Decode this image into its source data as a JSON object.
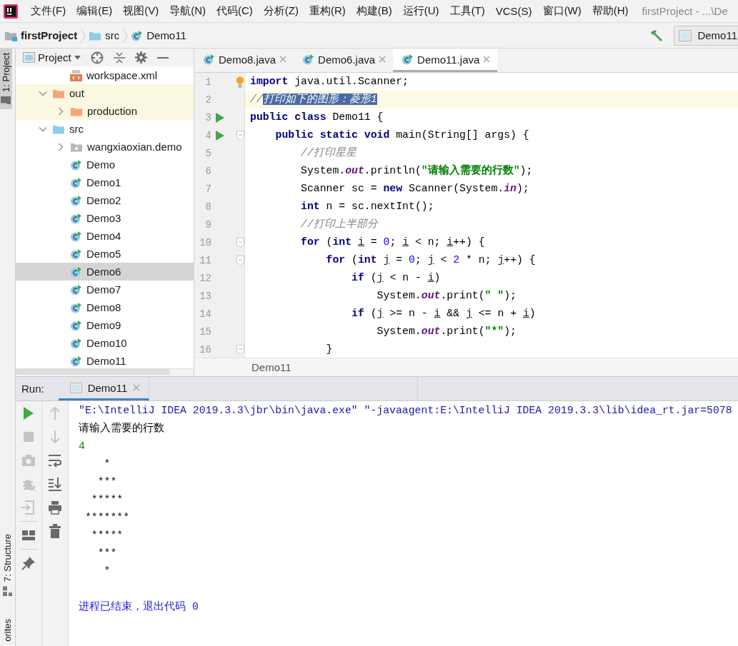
{
  "menu_bar": {
    "items": [
      "文件(F)",
      "编辑(E)",
      "视图(V)",
      "导航(N)",
      "代码(C)",
      "分析(Z)",
      "重构(R)",
      "构建(B)",
      "运行(U)",
      "工具(T)",
      "VCS(S)",
      "窗口(W)",
      "帮助(H)"
    ],
    "title": "firstProject - ...\\De"
  },
  "nav_bar": {
    "breadcrumbs": [
      {
        "label": "firstProject",
        "kind": "project"
      },
      {
        "label": "src",
        "kind": "folder"
      },
      {
        "label": "Demo11",
        "kind": "class"
      }
    ],
    "run_config": "Demo11"
  },
  "tool_stripe": {
    "top": [
      {
        "label": "1: Project",
        "selected": true
      }
    ],
    "bottom": [
      {
        "label": "7: Structure",
        "selected": false
      },
      {
        "label": "orites",
        "selected": false
      }
    ]
  },
  "project_panel": {
    "title": "Project",
    "tree": {
      "scrolled_parent_children": [
        {
          "label": "workspace.xml",
          "kind": "xml",
          "selected": false
        }
      ],
      "items": [
        {
          "label": "out",
          "kind": "excluded-folder",
          "expanded": true,
          "selected": false,
          "children": [
            {
              "label": "production",
              "kind": "excluded-folder",
              "expanded": false,
              "selected": false
            }
          ]
        },
        {
          "label": "src",
          "kind": "source-folder",
          "expanded": true,
          "selected": false,
          "children": [
            {
              "label": "wangxiaoxian.demo",
              "kind": "package",
              "expanded": false,
              "selected": false
            },
            {
              "label": "Demo",
              "kind": "class",
              "selected": false
            },
            {
              "label": "Demo1",
              "kind": "class",
              "selected": false
            },
            {
              "label": "Demo2",
              "kind": "class",
              "selected": false
            },
            {
              "label": "Demo3",
              "kind": "class",
              "selected": false
            },
            {
              "label": "Demo4",
              "kind": "class",
              "selected": false
            },
            {
              "label": "Demo5",
              "kind": "class",
              "selected": false
            },
            {
              "label": "Demo6",
              "kind": "class",
              "selected": true
            },
            {
              "label": "Demo7",
              "kind": "class",
              "selected": false
            },
            {
              "label": "Demo8",
              "kind": "class",
              "selected": false
            },
            {
              "label": "Demo9",
              "kind": "class",
              "selected": false
            },
            {
              "label": "Demo10",
              "kind": "class",
              "selected": false
            },
            {
              "label": "Demo11",
              "kind": "class",
              "selected": false
            }
          ]
        }
      ]
    }
  },
  "editor": {
    "tabs": [
      {
        "label": "Demo8.java",
        "selected": false
      },
      {
        "label": "Demo6.java",
        "selected": false
      },
      {
        "label": "Demo11.java",
        "selected": true
      }
    ],
    "lines": [
      {
        "number": "1",
        "current": false,
        "run": false,
        "fold": false,
        "bulb": true,
        "tokens": [
          {
            "text": "import",
            "kind": "keyword"
          },
          {
            "text": " java.util.Scanner;",
            "kind": "plain"
          }
        ]
      },
      {
        "number": "2",
        "current": true,
        "run": false,
        "fold": false,
        "tokens": [
          {
            "text": "//",
            "kind": "comment"
          },
          {
            "text": "打印如下的图形：菱形1",
            "kind": "comment",
            "selected": true
          }
        ]
      },
      {
        "number": "3",
        "current": false,
        "run": true,
        "fold": false,
        "tokens": [
          {
            "text": "public class",
            "kind": "keyword"
          },
          {
            "text": " Demo11 {",
            "kind": "plain"
          }
        ]
      },
      {
        "number": "4",
        "current": false,
        "run": true,
        "fold": true,
        "tokens": [
          {
            "text": "    public static void",
            "kind": "keyword"
          },
          {
            "text": " main(String[] args) {",
            "kind": "plain"
          }
        ]
      },
      {
        "number": "5",
        "current": false,
        "run": false,
        "fold": false,
        "tokens": [
          {
            "text": "        //打印星星",
            "kind": "comment"
          }
        ]
      },
      {
        "number": "6",
        "current": false,
        "run": false,
        "fold": false,
        "tokens": [
          {
            "text": "        System.",
            "kind": "plain"
          },
          {
            "text": "out",
            "kind": "field"
          },
          {
            "text": ".println(",
            "kind": "plain"
          },
          {
            "text": "\"请输入需要的行数\"",
            "kind": "string"
          },
          {
            "text": ");",
            "kind": "plain"
          }
        ]
      },
      {
        "number": "7",
        "current": false,
        "run": false,
        "fold": false,
        "tokens": [
          {
            "text": "        Scanner sc = ",
            "kind": "plain"
          },
          {
            "text": "new",
            "kind": "keyword"
          },
          {
            "text": " Scanner(System.",
            "kind": "plain"
          },
          {
            "text": "in",
            "kind": "field"
          },
          {
            "text": ");",
            "kind": "plain"
          }
        ]
      },
      {
        "number": "8",
        "current": false,
        "run": false,
        "fold": false,
        "tokens": [
          {
            "text": "        int",
            "kind": "keyword"
          },
          {
            "text": " n = sc.nextInt();",
            "kind": "plain"
          }
        ]
      },
      {
        "number": "9",
        "current": false,
        "run": false,
        "fold": false,
        "tokens": [
          {
            "text": "        //打印上半部分",
            "kind": "comment"
          }
        ]
      },
      {
        "number": "10",
        "current": false,
        "run": false,
        "fold": true,
        "tokens": [
          {
            "text": "        for",
            "kind": "keyword"
          },
          {
            "text": " (",
            "kind": "plain"
          },
          {
            "text": "int ",
            "kind": "keyword"
          },
          {
            "text": "i",
            "kind": "variable"
          },
          {
            "text": " = ",
            "kind": "plain"
          },
          {
            "text": "0",
            "kind": "number"
          },
          {
            "text": "; ",
            "kind": "plain"
          },
          {
            "text": "i",
            "kind": "variable"
          },
          {
            "text": " < n; ",
            "kind": "plain"
          },
          {
            "text": "i",
            "kind": "variable"
          },
          {
            "text": "++) {",
            "kind": "plain"
          }
        ]
      },
      {
        "number": "11",
        "current": false,
        "run": false,
        "fold": true,
        "tokens": [
          {
            "text": "            for",
            "kind": "keyword"
          },
          {
            "text": " (",
            "kind": "plain"
          },
          {
            "text": "int ",
            "kind": "keyword"
          },
          {
            "text": "j",
            "kind": "variable"
          },
          {
            "text": " = ",
            "kind": "plain"
          },
          {
            "text": "0",
            "kind": "number"
          },
          {
            "text": "; ",
            "kind": "plain"
          },
          {
            "text": "j",
            "kind": "variable"
          },
          {
            "text": " < ",
            "kind": "plain"
          },
          {
            "text": "2",
            "kind": "number"
          },
          {
            "text": " * n; ",
            "kind": "plain"
          },
          {
            "text": "j",
            "kind": "variable"
          },
          {
            "text": "++) {",
            "kind": "plain"
          }
        ]
      },
      {
        "number": "12",
        "current": false,
        "run": false,
        "fold": false,
        "tokens": [
          {
            "text": "                if",
            "kind": "keyword"
          },
          {
            "text": " (",
            "kind": "plain"
          },
          {
            "text": "j",
            "kind": "variable"
          },
          {
            "text": " < n - ",
            "kind": "plain"
          },
          {
            "text": "i",
            "kind": "variable"
          },
          {
            "text": ")",
            "kind": "plain"
          }
        ]
      },
      {
        "number": "13",
        "current": false,
        "run": false,
        "fold": false,
        "tokens": [
          {
            "text": "                    System.",
            "kind": "plain"
          },
          {
            "text": "out",
            "kind": "field"
          },
          {
            "text": ".print(",
            "kind": "plain"
          },
          {
            "text": "\" \"",
            "kind": "string"
          },
          {
            "text": ");",
            "kind": "plain"
          }
        ]
      },
      {
        "number": "14",
        "current": false,
        "run": false,
        "fold": false,
        "tokens": [
          {
            "text": "                if",
            "kind": "keyword"
          },
          {
            "text": " (",
            "kind": "plain"
          },
          {
            "text": "j",
            "kind": "variable"
          },
          {
            "text": " >= n - ",
            "kind": "plain"
          },
          {
            "text": "i",
            "kind": "variable"
          },
          {
            "text": " && ",
            "kind": "plain"
          },
          {
            "text": "j",
            "kind": "variable"
          },
          {
            "text": " <= n + ",
            "kind": "plain"
          },
          {
            "text": "i",
            "kind": "variable"
          },
          {
            "text": ")",
            "kind": "plain"
          }
        ]
      },
      {
        "number": "15",
        "current": false,
        "run": false,
        "fold": false,
        "tokens": [
          {
            "text": "                    System.",
            "kind": "plain"
          },
          {
            "text": "out",
            "kind": "field"
          },
          {
            "text": ".print(",
            "kind": "plain"
          },
          {
            "text": "\"*\"",
            "kind": "string"
          },
          {
            "text": ");",
            "kind": "plain"
          }
        ]
      },
      {
        "number": "16",
        "current": false,
        "run": false,
        "fold": true,
        "tokens": [
          {
            "text": "            }",
            "kind": "plain"
          }
        ]
      }
    ],
    "breadcrumb": "Demo11"
  },
  "run_panel": {
    "label": "Run:",
    "tabs": [
      {
        "label": "Demo11",
        "selected": true
      }
    ],
    "toolbar_left": [
      {
        "kind": "run",
        "disabled": false
      },
      {
        "kind": "stop",
        "disabled": true
      },
      {
        "kind": "camera",
        "disabled": true
      },
      {
        "kind": "bug",
        "disabled": true
      },
      {
        "kind": "import",
        "disabled": true
      },
      {
        "kind": "separator"
      },
      {
        "kind": "layout",
        "disabled": false
      },
      {
        "kind": "separator"
      },
      {
        "kind": "pin",
        "disabled": false
      }
    ],
    "toolbar_right": [
      {
        "kind": "up",
        "disabled": true
      },
      {
        "kind": "down",
        "disabled": true
      },
      {
        "kind": "wrap",
        "disabled": false
      },
      {
        "kind": "scroll-end",
        "disabled": false
      },
      {
        "kind": "print",
        "disabled": false
      },
      {
        "kind": "trash",
        "disabled": false
      }
    ],
    "console": [
      {
        "text": "\"E:\\IntelliJ IDEA 2019.3.3\\jbr\\bin\\java.exe\" \"-javaagent:E:\\IntelliJ IDEA 2019.3.3\\lib\\idea_rt.jar=5078",
        "kind": "command"
      },
      {
        "text": "请输入需要的行数",
        "kind": "output"
      },
      {
        "text": "4",
        "kind": "input"
      },
      {
        "text": "    *\n   ***\n  *****\n *******\n  *****\n   ***\n    *",
        "kind": "output"
      },
      {
        "text": "进程已结束，退出代码 0",
        "kind": "exit"
      }
    ]
  }
}
